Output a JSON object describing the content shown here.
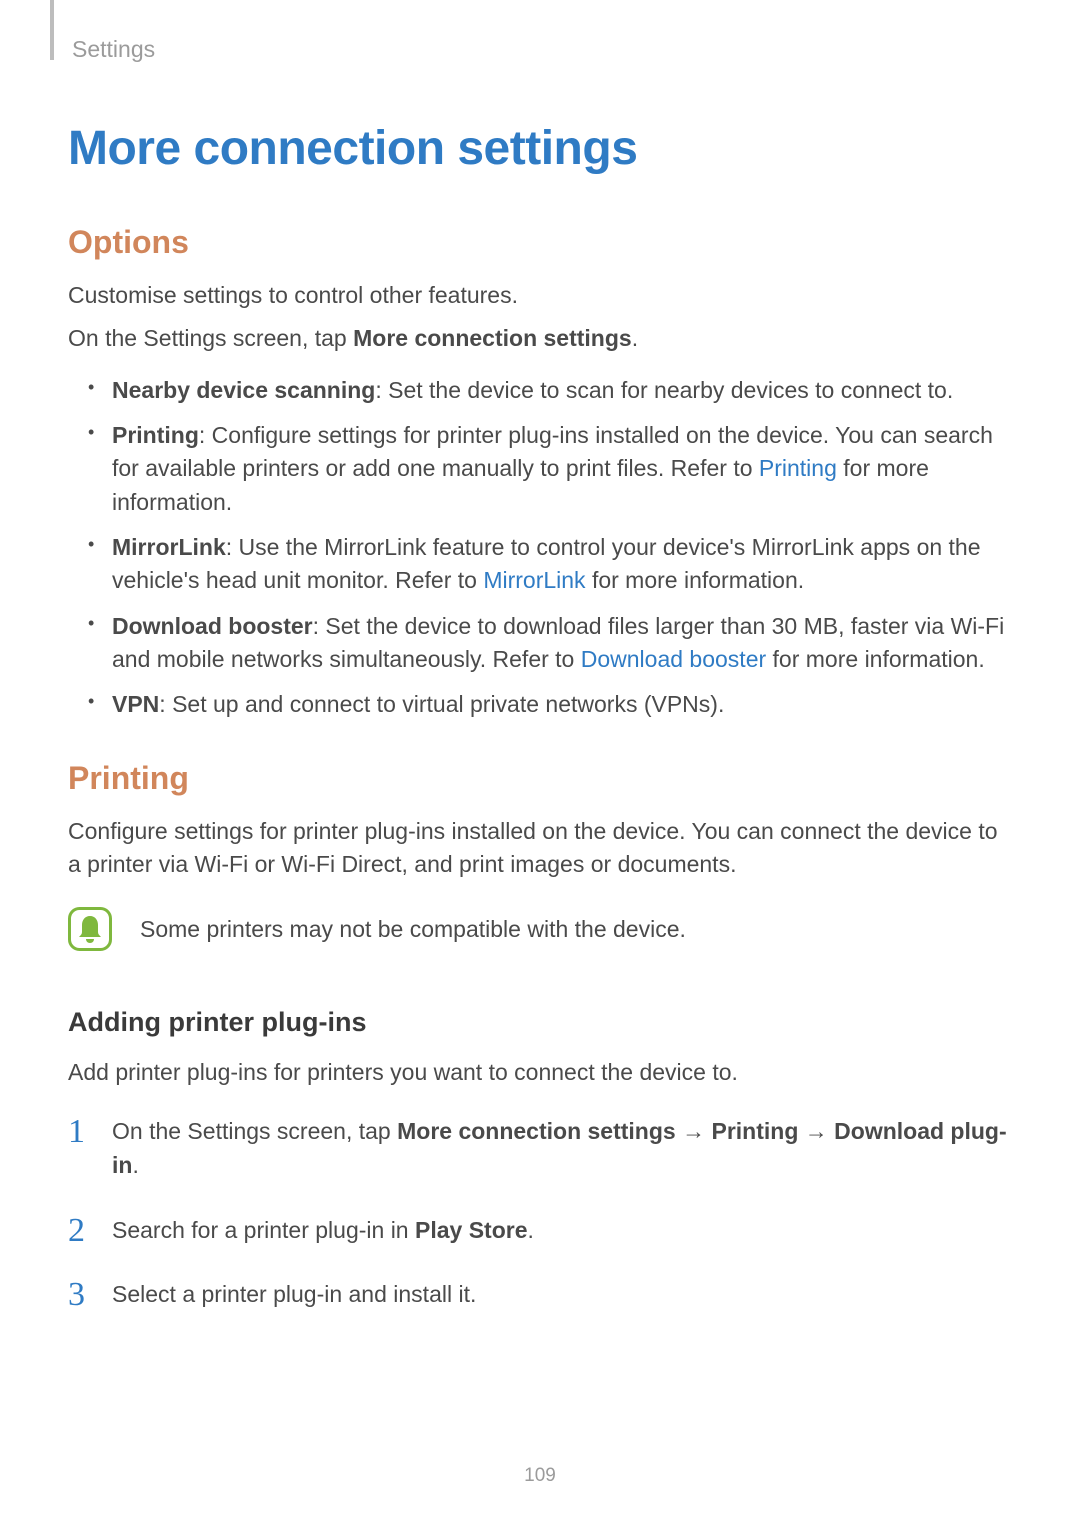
{
  "breadcrumb": "Settings",
  "title": "More connection settings",
  "page_number": "109",
  "options": {
    "heading": "Options",
    "intro": "Customise settings to control other features.",
    "instruction_prefix": "On the Settings screen, tap ",
    "instruction_bold": "More connection settings",
    "instruction_suffix": ".",
    "items": [
      {
        "term": "Nearby device scanning",
        "desc": ": Set the device to scan for nearby devices to connect to."
      },
      {
        "term": "Printing",
        "desc_before": ": Configure settings for printer plug-ins installed on the device. You can search for available printers or add one manually to print files. Refer to ",
        "link": "Printing",
        "desc_after": " for more information."
      },
      {
        "term": "MirrorLink",
        "desc_before": ": Use the MirrorLink feature to control your device's MirrorLink apps on the vehicle's head unit monitor. Refer to ",
        "link": "MirrorLink",
        "desc_after": " for more information."
      },
      {
        "term": "Download booster",
        "desc_before": ": Set the device to download files larger than 30 MB, faster via Wi-Fi and mobile networks simultaneously. Refer to ",
        "link": "Download booster",
        "desc_after": " for more information."
      },
      {
        "term": "VPN",
        "desc": ": Set up and connect to virtual private networks (VPNs)."
      }
    ]
  },
  "printing": {
    "heading": "Printing",
    "intro": "Configure settings for printer plug-ins installed on the device. You can connect the device to a printer via Wi-Fi or Wi-Fi Direct, and print images or documents.",
    "note": "Some printers may not be compatible with the device.",
    "sub_heading": "Adding printer plug-ins",
    "sub_intro": "Add printer plug-ins for printers you want to connect the device to.",
    "steps": {
      "s1": {
        "num": "1",
        "prefix": "On the Settings screen, tap ",
        "b1": "More connection settings",
        "arrow1": " → ",
        "b2": "Printing",
        "arrow2": " → ",
        "b3": "Download plug-in",
        "suffix": "."
      },
      "s2": {
        "num": "2",
        "prefix": "Search for a printer plug-in in ",
        "b1": "Play Store",
        "suffix": "."
      },
      "s3": {
        "num": "3",
        "text": "Select a printer plug-in and install it."
      }
    }
  }
}
